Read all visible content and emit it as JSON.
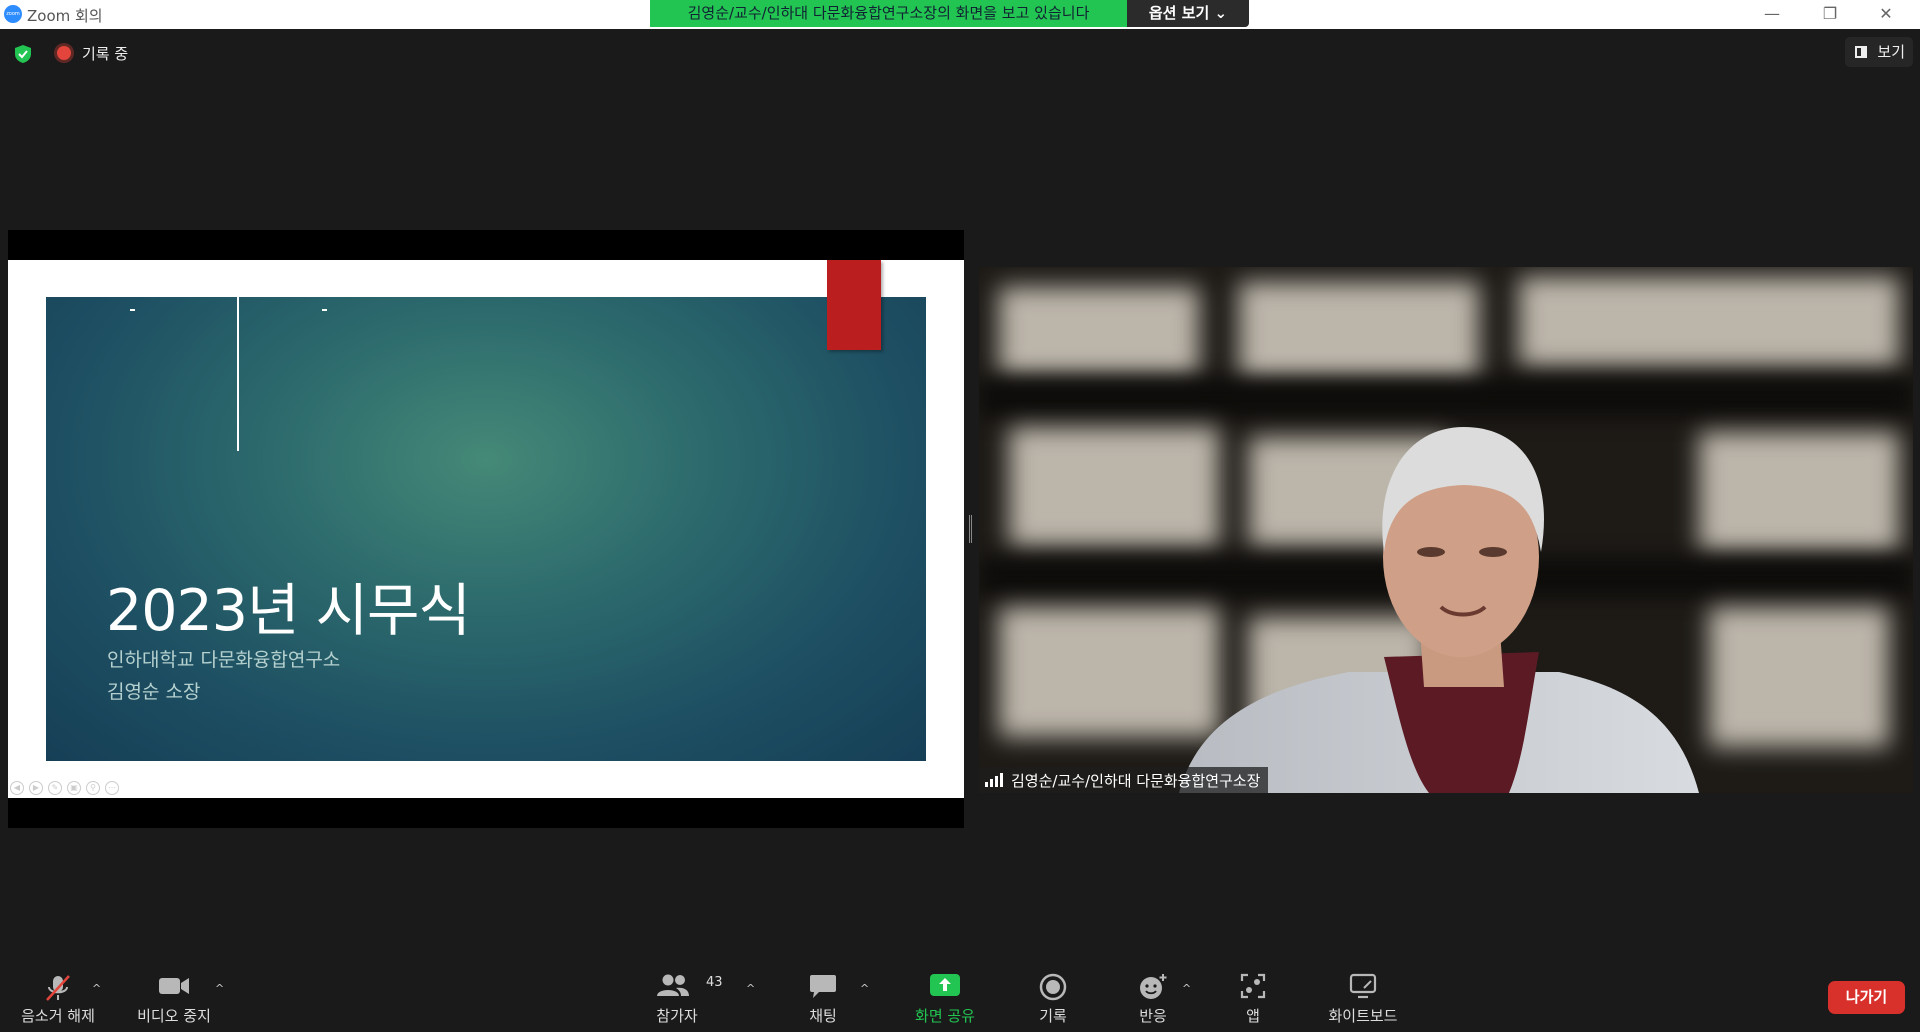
{
  "window": {
    "app_logo_text": "zoom",
    "title": "Zoom 회의",
    "controls": [
      "—",
      "❐",
      "✕"
    ]
  },
  "share_banner": {
    "text": "김영순/교수/인하대 다문화융합연구소장의 화면을 보고 있습니다",
    "options_label": "옵션 보기",
    "options_caret": "⌄",
    "color": "#23c552"
  },
  "status": {
    "recording_label": "기록 중",
    "view_label": "보기"
  },
  "slide": {
    "title": "2023년 시무식",
    "subtitle_1": "인하대학교 다문화융합연구소",
    "subtitle_2": "김영순 소장",
    "tools": [
      "◀",
      "▶",
      "✎",
      "▣",
      "⚲",
      "⋯"
    ]
  },
  "video": {
    "participant_name": "김영순/교수/인하대 다문화융합연구소장"
  },
  "toolbar": {
    "unmute_label": "음소거 해제",
    "stop_video_label": "비디오 중지",
    "participants_label": "참가자",
    "participants_count": "43",
    "chat_label": "채팅",
    "share_label": "화면 공유",
    "record_label": "기록",
    "reactions_label": "반응",
    "apps_label": "앱",
    "whiteboard_label": "화이트보드",
    "leave_label": "나가기",
    "caret": "^",
    "share_color": "#23c552",
    "leave_color": "#d8312b"
  }
}
